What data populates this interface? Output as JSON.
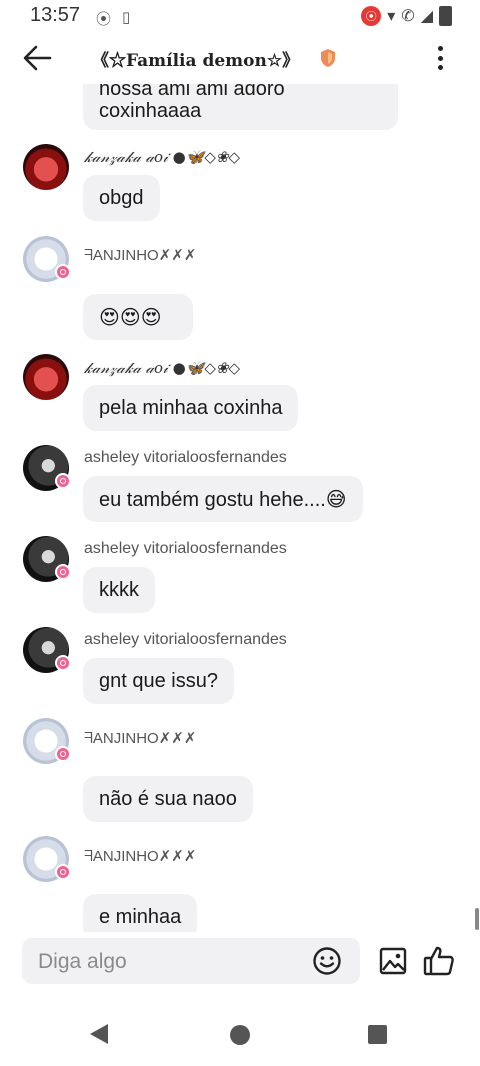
{
  "status": {
    "time": "13:57",
    "left_icons": [
      "⦿",
      "▯"
    ],
    "right_icons": [
      "▾",
      "✆",
      "◢"
    ],
    "record_icon": "⦿"
  },
  "header": {
    "title": "《☆Família demon☆》",
    "back_icon": "arrow-left-icon",
    "menu_icon": "more-vertical-icon"
  },
  "messages": [
    {
      "type": "bubble",
      "text": "nossa ami ami adoro\ncoxinhaaaa"
    },
    {
      "type": "name",
      "sender": "𝓀𝒶𝓃𝓏𝒶𝓀𝒶 𝒶𝑜𝒾 ●🦋◇❀◇"
    },
    {
      "type": "bubble",
      "text": "obgd"
    },
    {
      "type": "name",
      "sender": "ᖷANJINHO✗✗✗"
    },
    {
      "type": "bubble",
      "text": "😍😍😍"
    },
    {
      "type": "name",
      "sender": "𝓀𝒶𝓃𝓏𝒶𝓀𝒶 𝒶𝑜𝒾 ●🦋◇❀◇"
    },
    {
      "type": "bubble",
      "text": "pela minhaa coxinha"
    },
    {
      "type": "name",
      "sender": "asheley vitorialoosfernandes"
    },
    {
      "type": "bubble",
      "text": "eu também gostu hehe....😅"
    },
    {
      "type": "name",
      "sender": "asheley vitorialoosfernandes"
    },
    {
      "type": "bubble",
      "text": "kkkk"
    },
    {
      "type": "name",
      "sender": "asheley vitorialoosfernandes"
    },
    {
      "type": "bubble",
      "text": "gnt que issu?"
    },
    {
      "type": "name",
      "sender": "ᖷANJINHO✗✗✗"
    },
    {
      "type": "bubble",
      "text": "não é sua naoo"
    },
    {
      "type": "name",
      "sender": "ᖷANJINHO✗✗✗"
    },
    {
      "type": "bubble",
      "text": "e minhaa"
    }
  ],
  "composer": {
    "placeholder": "Diga algo",
    "emoji_icon": "emoji-icon",
    "image_icon": "image-icon",
    "like_icon": "thumbs-up-icon"
  },
  "nav": {
    "back": "nav-back-icon",
    "home": "nav-home-icon",
    "recents": "nav-recents-icon"
  },
  "colors": {
    "bubble": "#f1f1f3",
    "record": "#e53935",
    "badge": "#f06292"
  }
}
